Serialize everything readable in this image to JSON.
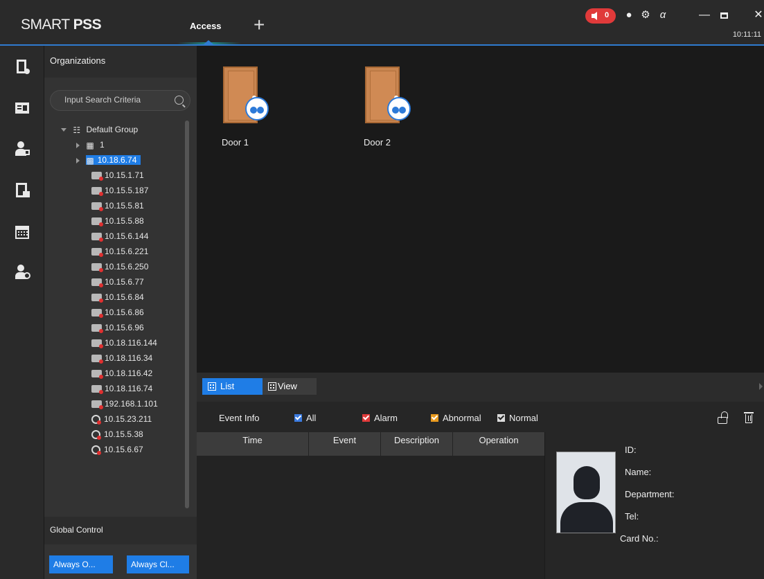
{
  "app": {
    "logo_light": "SMART ",
    "logo_bold": "PSS",
    "active_tab": "Access",
    "add_tab_symbol": "+",
    "alarm_count": "0",
    "clock": "10:11:11",
    "accent_color": "#1f7de6"
  },
  "rail": {
    "items": [
      "door-control-icon",
      "card-icon",
      "person-lock-icon",
      "door-lock-icon",
      "calendar-icon",
      "person-settings-icon"
    ]
  },
  "organizations": {
    "title": "Organizations",
    "search_placeholder": "Input Search Criteria",
    "tree": {
      "root": "Default Group",
      "map_node": "1",
      "selected_node": "10.18.6.74",
      "devices": [
        "10.15.1.71",
        "10.15.5.187",
        "10.15.5.81",
        "10.15.5.88",
        "10.15.6.144",
        "10.15.6.221",
        "10.15.6.250",
        "10.15.6.77",
        "10.15.6.84",
        "10.15.6.86",
        "10.15.6.96",
        "10.18.116.144",
        "10.18.116.34",
        "10.18.116.42",
        "10.18.116.74",
        "192.168.1.101"
      ],
      "cameras": [
        "10.15.23.211",
        "10.15.5.38",
        "10.15.6.67"
      ]
    }
  },
  "global_control": {
    "title": "Global Control",
    "always_open": "Always O...",
    "always_close": "Always Cl..."
  },
  "doors": [
    {
      "label": "Door 1"
    },
    {
      "label": "Door 2"
    }
  ],
  "events": {
    "tab_list": "List",
    "tab_view": "View",
    "event_info_label": "Event Info",
    "filters": {
      "all": "All",
      "alarm": "Alarm",
      "abnormal": "Abnormal",
      "normal": "Normal"
    },
    "columns": {
      "time": "Time",
      "event": "Event",
      "description": "Description",
      "operation": "Operation"
    }
  },
  "person": {
    "id_label": "ID:",
    "name_label": "Name:",
    "department_label": "Department:",
    "tel_label": "Tel:",
    "card_label": "Card No.:"
  }
}
